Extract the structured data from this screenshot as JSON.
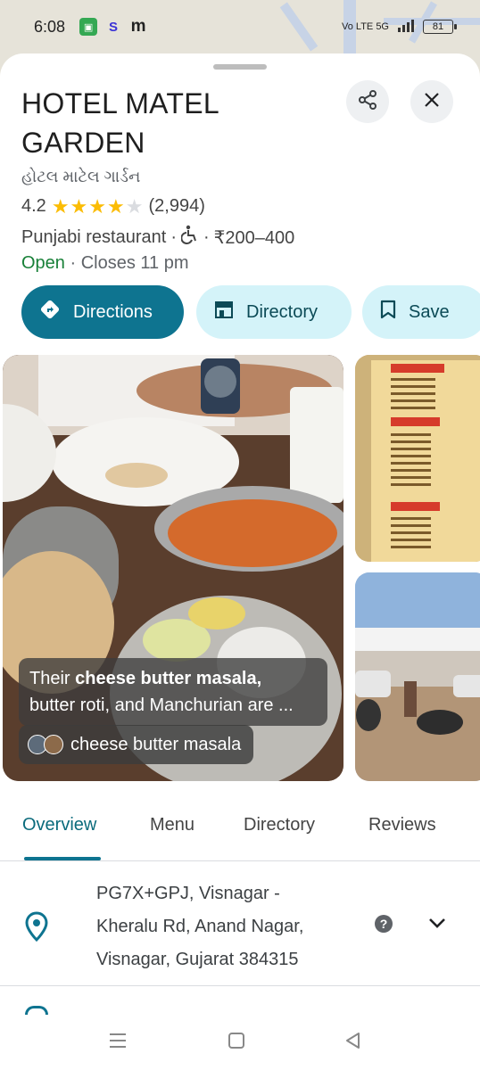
{
  "status_bar": {
    "time": "6:08",
    "notif_icons": [
      "app-icon",
      "s-icon",
      "m-icon"
    ],
    "notif_labels": [
      "",
      "S",
      "m"
    ],
    "network": "Vo LTE 5G",
    "battery": "81"
  },
  "place": {
    "title": "HOTEL MATEL GARDEN",
    "alt_name": "હોટલ માટેલ ગાર્ડન",
    "rating": "4.2",
    "rating_value": 4.2,
    "review_count": "(2,994)",
    "category": "Punjabi restaurant",
    "separator": "·",
    "price": "₹200–400",
    "status": "Open",
    "hours": "· Closes 11 pm"
  },
  "actions": {
    "directions": "Directions",
    "directory": "Directory",
    "save": "Save"
  },
  "photo": {
    "caption_prefix": "Their ",
    "caption_bold": "cheese butter masala,",
    "caption_rest": "butter roti, and Manchurian are ...",
    "tag": "cheese butter masala"
  },
  "tabs": [
    "Overview",
    "Menu",
    "Directory",
    "Reviews"
  ],
  "address": {
    "line1": "PG7X+GPJ, Visnagar -",
    "line2": "Kheralu Rd, Anand Nagar,",
    "line3": "Visnagar, Gujarat 384315"
  },
  "colors": {
    "accent": "#0e7490",
    "chip_bg": "#d4f3f9",
    "star": "#fbbc04",
    "open": "#188038"
  }
}
